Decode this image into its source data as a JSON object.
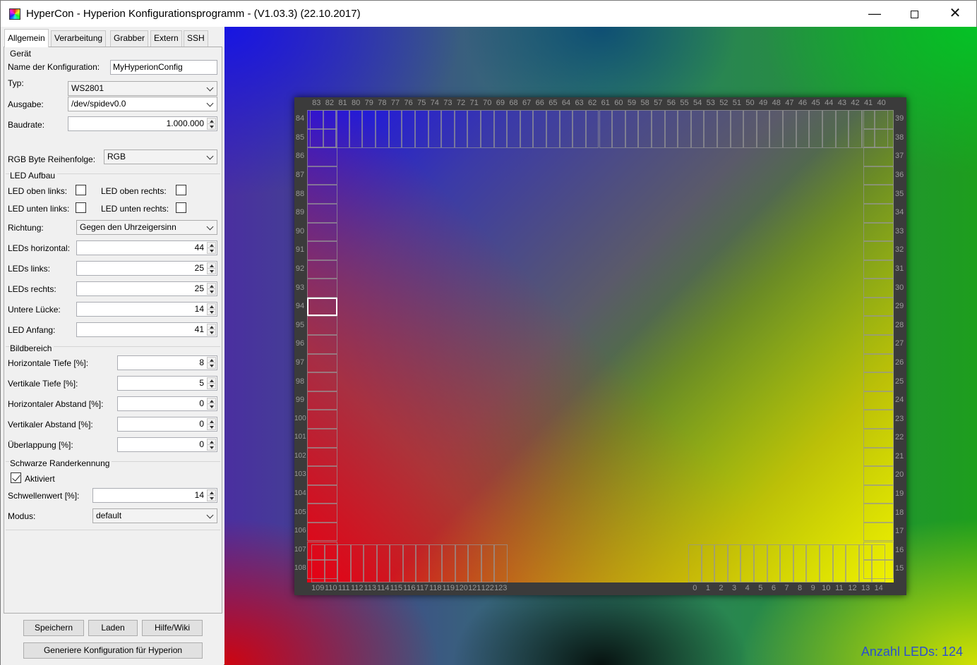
{
  "window": {
    "title": "HyperCon - Hyperion Konfigurationsprogramm - (V1.03.3) (22.10.2017)",
    "minimize": "—",
    "close": "✕"
  },
  "tabs": [
    "Allgemein",
    "Verarbeitung",
    "Grabber",
    "Extern",
    "SSH"
  ],
  "geraet": {
    "group": "Gerät",
    "name_label": "Name der Konfiguration:",
    "name_value": "MyHyperionConfig",
    "typ_label": "Typ:",
    "typ_value": "WS2801",
    "ausgabe_label": "Ausgabe:",
    "ausgabe_value": "/dev/spidev0.0",
    "baud_label": "Baudrate:",
    "baud_value": "1.000.000",
    "rgb_label": "RGB Byte Reihenfolge:",
    "rgb_value": "RGB"
  },
  "led_aufbau": {
    "group": "LED Aufbau",
    "oben_links": "LED oben links:",
    "oben_rechts": "LED oben rechts:",
    "unten_links": "LED unten links:",
    "unten_rechts": "LED unten rechts:",
    "richtung_label": "Richtung:",
    "richtung_value": "Gegen den Uhrzeigersinn",
    "horizontal_label": "LEDs horizontal:",
    "horizontal_value": "44",
    "links_label": "LEDs links:",
    "links_value": "25",
    "rechts_label": "LEDs rechts:",
    "rechts_value": "25",
    "luecke_label": "Untere Lücke:",
    "luecke_value": "14",
    "anfang_label": "LED Anfang:",
    "anfang_value": "41"
  },
  "bildbereich": {
    "group": "Bildbereich",
    "htiefe_label": "Horizontale Tiefe [%]:",
    "htiefe_value": "8",
    "vtiefe_label": "Vertikale Tiefe [%]:",
    "vtiefe_value": "5",
    "habstand_label": "Horizontaler Abstand [%]:",
    "habstand_value": "0",
    "vabstand_label": "Vertikaler Abstand [%]:",
    "vabstand_value": "0",
    "ueberlappung_label": "Überlappung [%]:",
    "ueberlappung_value": "0"
  },
  "schwarz": {
    "group": "Schwarze Randerkennung",
    "aktiviert": "Aktiviert",
    "schwelle_label": "Schwellenwert [%]:",
    "schwelle_value": "14",
    "modus_label": "Modus:",
    "modus_value": "default"
  },
  "buttons": {
    "speichern": "Speichern",
    "laden": "Laden",
    "hilfe": "Hilfe/Wiki",
    "generieren": "Generiere Konfiguration für Hyperion"
  },
  "preview": {
    "led_count": "Anzahl LEDs: 124",
    "top_numbers": [
      "83",
      "82",
      "81",
      "80",
      "79",
      "78",
      "77",
      "76",
      "75",
      "74",
      "73",
      "72",
      "71",
      "70",
      "69",
      "68",
      "67",
      "66",
      "65",
      "64",
      "63",
      "62",
      "61",
      "60",
      "59",
      "58",
      "57",
      "56",
      "55",
      "54",
      "53",
      "52",
      "51",
      "50",
      "49",
      "48",
      "47",
      "46",
      "45",
      "44",
      "43",
      "42",
      "41",
      "40"
    ],
    "left_numbers": [
      "84",
      "85",
      "86",
      "87",
      "88",
      "89",
      "90",
      "91",
      "92",
      "93",
      "94",
      "95",
      "96",
      "97",
      "98",
      "99",
      "100",
      "101",
      "102",
      "103",
      "104",
      "105",
      "106",
      "107",
      "108"
    ],
    "right_numbers": [
      "39",
      "38",
      "37",
      "36",
      "35",
      "34",
      "33",
      "32",
      "31",
      "30",
      "29",
      "28",
      "27",
      "26",
      "25",
      "24",
      "23",
      "22",
      "21",
      "20",
      "19",
      "18",
      "17",
      "16",
      "15"
    ],
    "bottom_left_numbers": [
      "109",
      "110",
      "111",
      "112",
      "113",
      "114",
      "115",
      "116",
      "117",
      "118",
      "119",
      "120",
      "121",
      "122",
      "123"
    ],
    "bottom_right_numbers": [
      "0",
      "1",
      "2",
      "3",
      "4",
      "5",
      "6",
      "7",
      "8",
      "9",
      "10",
      "11",
      "12",
      "13",
      "14"
    ]
  }
}
